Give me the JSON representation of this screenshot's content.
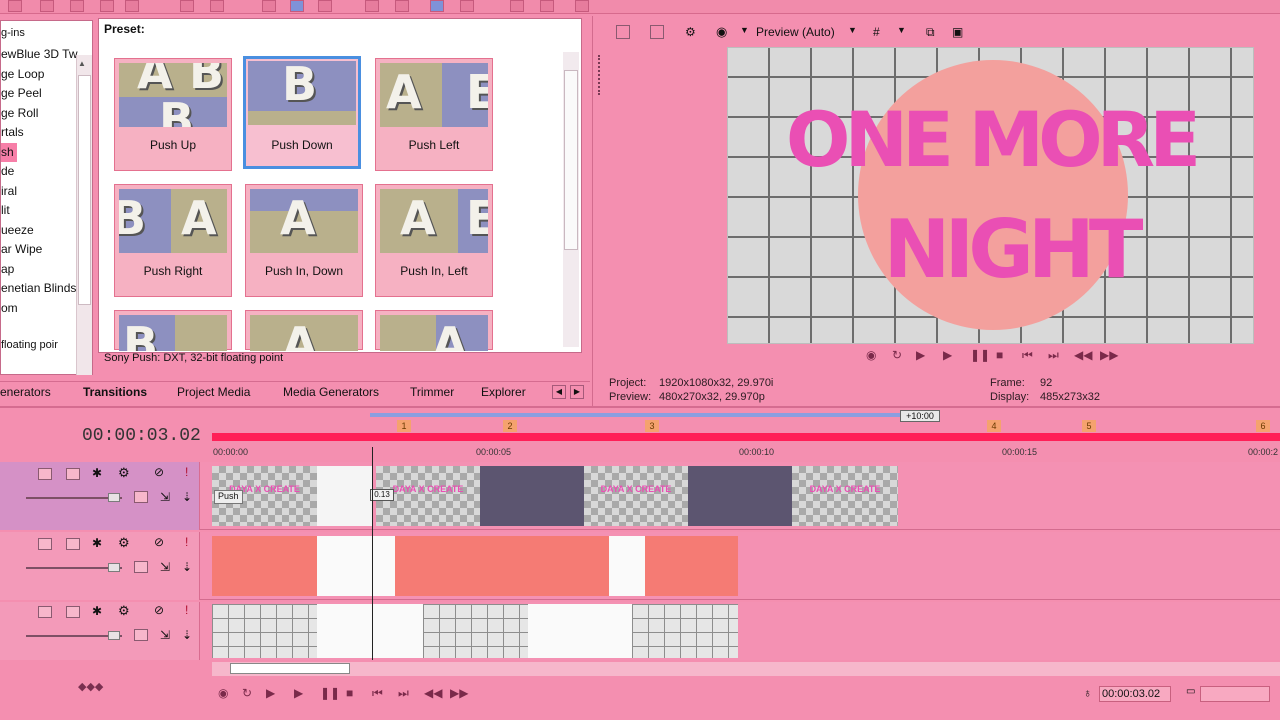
{
  "left_list": {
    "top_label": "g-ins",
    "items": [
      "ewBlue 3D Tw",
      "ge Loop",
      "ge Peel",
      "ge Roll",
      "rtals",
      "sh",
      "de",
      "iral",
      "lit",
      "ueeze",
      "ar Wipe",
      "ap",
      "enetian Blinds",
      "om"
    ],
    "selected_index": 5,
    "footer": "floating poir"
  },
  "preset": {
    "label": "Preset:",
    "items": [
      {
        "caption": "Push Up",
        "selected": false
      },
      {
        "caption": "Push Down",
        "selected": true
      },
      {
        "caption": "Push Left",
        "selected": false
      },
      {
        "caption": "Push Right",
        "selected": false
      },
      {
        "caption": "Push In, Down",
        "selected": false
      },
      {
        "caption": "Push In, Left",
        "selected": false
      }
    ],
    "status": "Sony Push: DXT, 32-bit floating point"
  },
  "tabs": {
    "items": [
      "enerators",
      "Transitions",
      "Project Media",
      "Media Generators",
      "Trimmer",
      "Explorer"
    ],
    "active": "Transitions"
  },
  "preview": {
    "mode_label": "Preview (Auto)",
    "title_line1": "ONE MORE",
    "title_line2": "NIGHT",
    "project_label": "Project:",
    "project_value": "1920x1080x32, 29.970i",
    "preview_label": "Preview:",
    "preview_value": "480x270x32, 29.970p",
    "frame_label": "Frame:",
    "frame_value": "92",
    "display_label": "Display:",
    "display_value": "485x273x32"
  },
  "timeline": {
    "current_time": "00:00:03.02",
    "region_length": "+10:00",
    "ruler_labels": [
      "00:00:00",
      "00:00:05",
      "00:00:10",
      "00:00:15",
      "00:00:2"
    ],
    "markers": [
      "1",
      "2",
      "3",
      "4",
      "5",
      "6"
    ],
    "clip_title": "DAYA X CREATE",
    "transition_tag": "Push",
    "transition_length": "0.13",
    "bottom_time": "00:00:03.02"
  },
  "colors": {
    "background": "#f48fb0",
    "accent_red": "#ff1f57",
    "title_pink": "#ea4fb4",
    "circle": "#f3a09d",
    "salmon_clip": "#f57b74",
    "selection_blue": "#4a8fe0"
  }
}
